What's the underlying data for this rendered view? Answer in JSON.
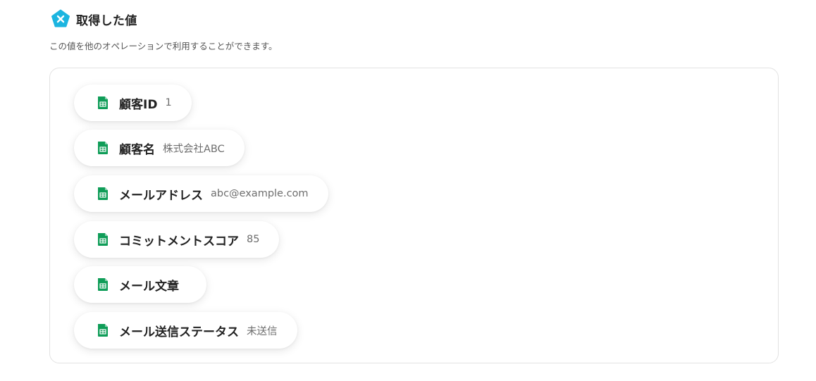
{
  "header": {
    "icon": "yoom-pentagon-icon",
    "icon_color": "#1cb5e0",
    "title": "取得した値"
  },
  "subtitle": "この値を他のオペレーションで利用することができます。",
  "outputs": [
    {
      "label": "顧客ID",
      "value": "1",
      "icon": "google-sheets-icon"
    },
    {
      "label": "顧客名",
      "value": "株式会社ABC",
      "icon": "google-sheets-icon"
    },
    {
      "label": "メールアドレス",
      "value": "abc@example.com",
      "icon": "google-sheets-icon"
    },
    {
      "label": "コミットメントスコア",
      "value": "85",
      "icon": "google-sheets-icon"
    },
    {
      "label": "メール文章",
      "value": "",
      "icon": "google-sheets-icon"
    },
    {
      "label": "メール送信ステータス",
      "value": "未送信",
      "icon": "google-sheets-icon"
    }
  ],
  "colors": {
    "sheets_green": "#0f9d58",
    "panel_border": "#e2e2e2"
  }
}
